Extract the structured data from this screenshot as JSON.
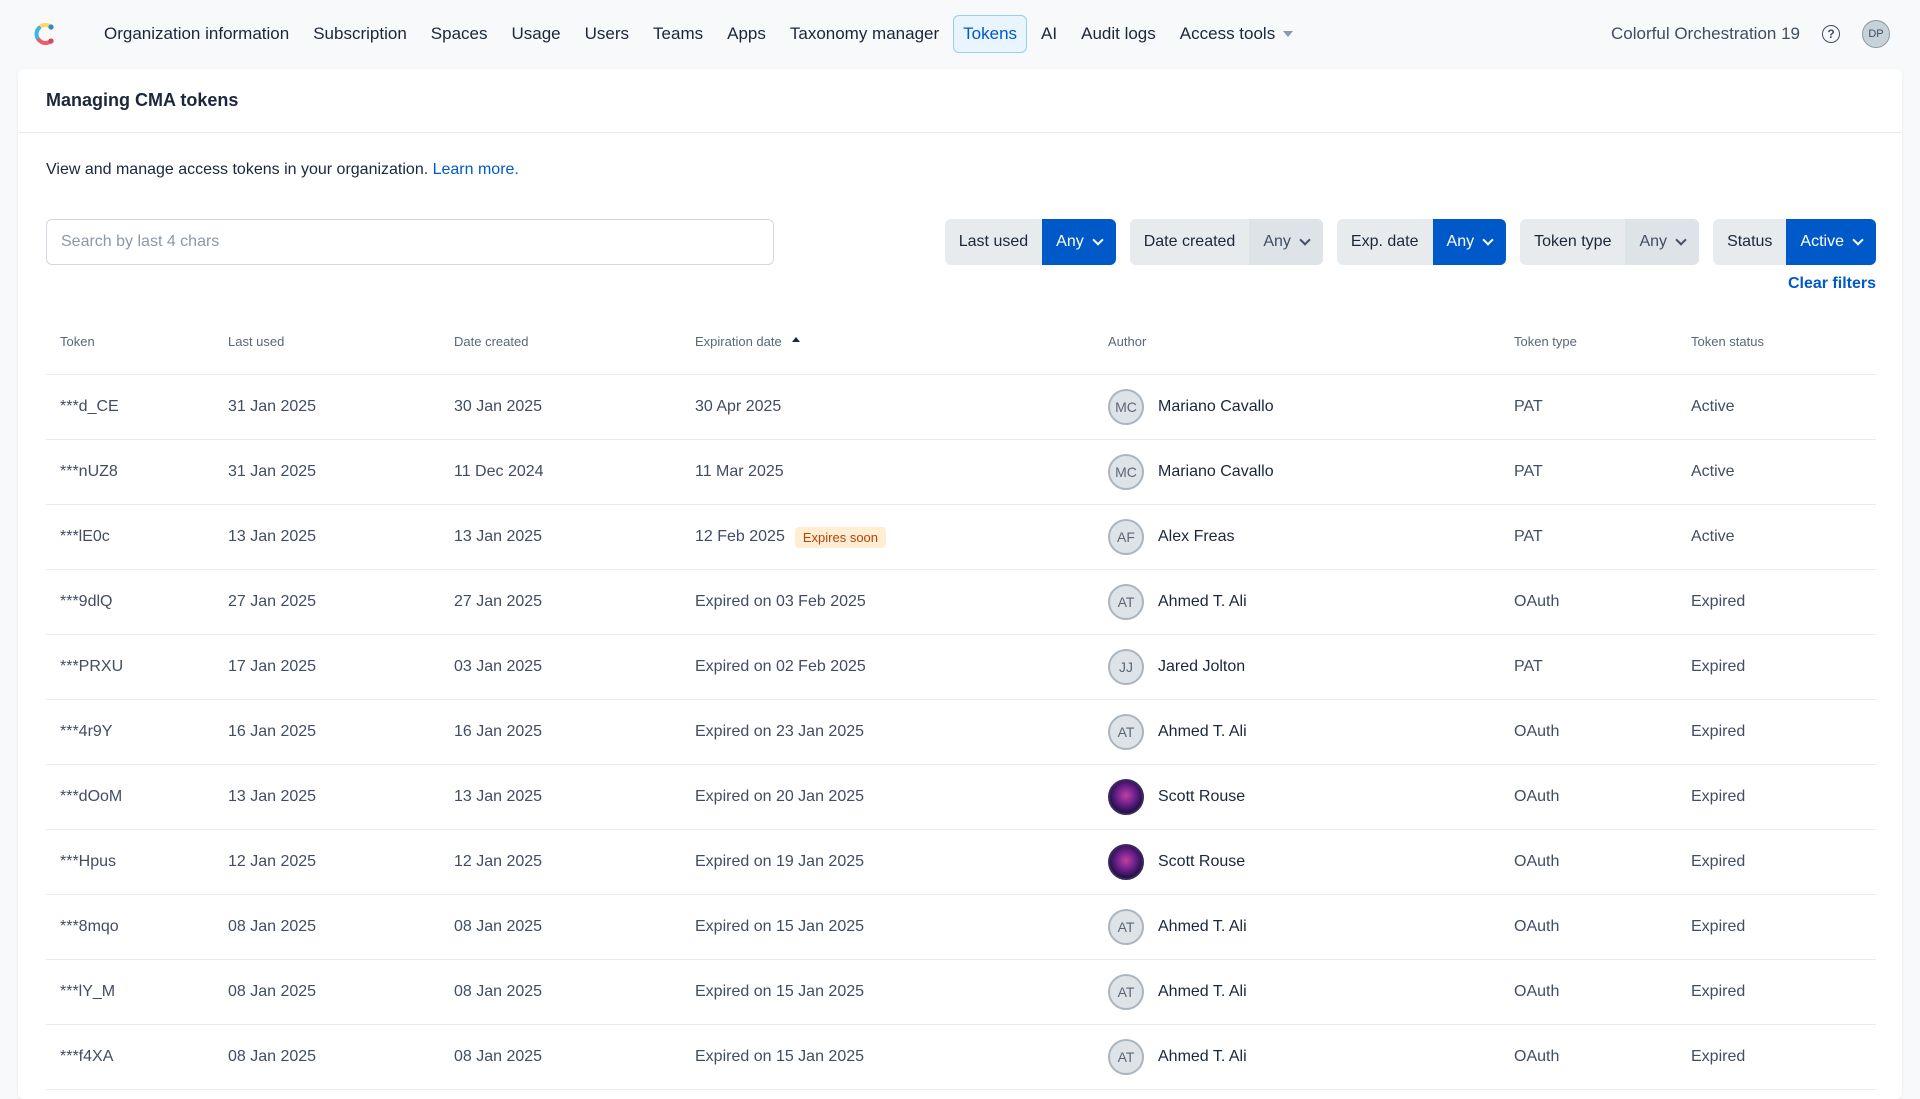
{
  "nav": {
    "items": [
      {
        "label": "Organization information"
      },
      {
        "label": "Subscription"
      },
      {
        "label": "Spaces"
      },
      {
        "label": "Usage"
      },
      {
        "label": "Users"
      },
      {
        "label": "Teams"
      },
      {
        "label": "Apps"
      },
      {
        "label": "Taxonomy manager"
      },
      {
        "label": "Tokens",
        "active": true
      },
      {
        "label": "AI"
      },
      {
        "label": "Audit logs"
      },
      {
        "label": "Access tools"
      }
    ],
    "org_name": "Colorful Orchestration 19",
    "help_icon": "?",
    "user_initials": "DP"
  },
  "page": {
    "title": "Managing CMA tokens",
    "description": "View and manage access tokens in your organization.",
    "learn_more": "Learn more."
  },
  "search": {
    "placeholder": "Search by last 4 chars",
    "value": ""
  },
  "filters": [
    {
      "label": "Last used",
      "value": "Any"
    },
    {
      "label": "Date created",
      "value": "Any"
    },
    {
      "label": "Exp. date",
      "value": "Any"
    },
    {
      "label": "Token type",
      "value": "Any"
    },
    {
      "label": "Status",
      "value": "Active"
    }
  ],
  "clear_filters": "Clear filters",
  "table": {
    "columns": [
      "Token",
      "Last used",
      "Date created",
      "Expiration date",
      "Author",
      "Token type",
      "Token status"
    ],
    "rows": [
      {
        "token": "***d_CE",
        "last_used": "31 Jan 2025",
        "created": "30 Jan 2025",
        "expiration": "30 Apr 2025",
        "badge": "",
        "initials": "MC",
        "author": "Mariano Cavallo",
        "type": "PAT",
        "status": "Active"
      },
      {
        "token": "***nUZ8",
        "last_used": "31 Jan 2025",
        "created": "11 Dec 2024",
        "expiration": "11 Mar 2025",
        "badge": "",
        "initials": "MC",
        "author": "Mariano Cavallo",
        "type": "PAT",
        "status": "Active"
      },
      {
        "token": "***lE0c",
        "last_used": "13 Jan 2025",
        "created": "13 Jan 2025",
        "expiration": "12 Feb 2025",
        "badge": "Expires soon",
        "initials": "AF",
        "author": "Alex Freas",
        "type": "PAT",
        "status": "Active"
      },
      {
        "token": "***9dlQ",
        "last_used": "27 Jan 2025",
        "created": "27 Jan 2025",
        "expiration": "Expired on 03 Feb 2025",
        "badge": "",
        "initials": "AT",
        "author": "Ahmed T. Ali",
        "type": "OAuth",
        "status": "Expired"
      },
      {
        "token": "***PRXU",
        "last_used": "17 Jan 2025",
        "created": "03 Jan 2025",
        "expiration": "Expired on 02 Feb 2025",
        "badge": "",
        "initials": "JJ",
        "author": "Jared Jolton",
        "type": "PAT",
        "status": "Expired"
      },
      {
        "token": "***4r9Y",
        "last_used": "16 Jan 2025",
        "created": "16 Jan 2025",
        "expiration": "Expired on 23 Jan 2025",
        "badge": "",
        "initials": "AT",
        "author": "Ahmed T. Ali",
        "type": "OAuth",
        "status": "Expired"
      },
      {
        "token": "***dOoM",
        "last_used": "13 Jan 2025",
        "created": "13 Jan 2025",
        "expiration": "Expired on 20 Jan 2025",
        "badge": "",
        "initials": "",
        "photo": true,
        "author": "Scott Rouse",
        "type": "OAuth",
        "status": "Expired"
      },
      {
        "token": "***Hpus",
        "last_used": "12 Jan 2025",
        "created": "12 Jan 2025",
        "expiration": "Expired on 19 Jan 2025",
        "badge": "",
        "initials": "",
        "photo": true,
        "author": "Scott Rouse",
        "type": "OAuth",
        "status": "Expired"
      },
      {
        "token": "***8mqo",
        "last_used": "08 Jan 2025",
        "created": "08 Jan 2025",
        "expiration": "Expired on 15 Jan 2025",
        "badge": "",
        "initials": "AT",
        "author": "Ahmed T. Ali",
        "type": "OAuth",
        "status": "Expired"
      },
      {
        "token": "***lY_M",
        "last_used": "08 Jan 2025",
        "created": "08 Jan 2025",
        "expiration": "Expired on 15 Jan 2025",
        "badge": "",
        "initials": "AT",
        "author": "Ahmed T. Ali",
        "type": "OAuth",
        "status": "Expired"
      },
      {
        "token": "***f4XA",
        "last_used": "08 Jan 2025",
        "created": "08 Jan 2025",
        "expiration": "Expired on 15 Jan 2025",
        "badge": "",
        "initials": "AT",
        "author": "Ahmed T. Ali",
        "type": "OAuth",
        "status": "Expired"
      }
    ]
  },
  "colors": {
    "accent": "#0059c8",
    "badge_bg": "#ffeed2",
    "badge_text": "#b5420c"
  }
}
